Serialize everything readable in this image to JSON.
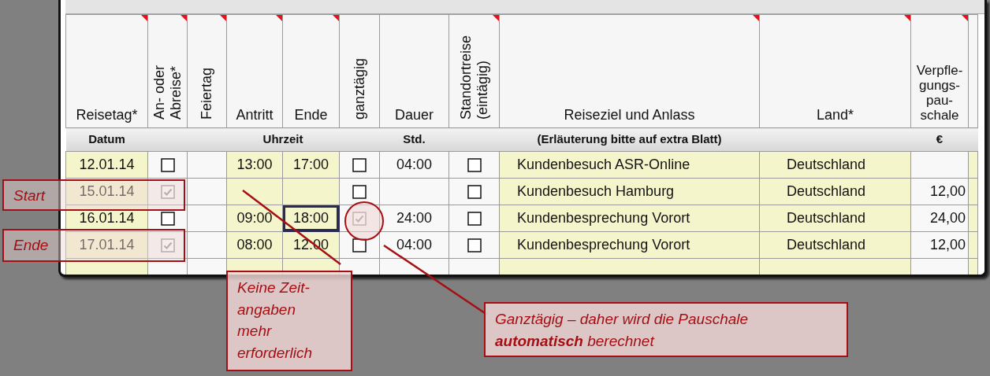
{
  "columns": [
    {
      "label": "Reisetag*",
      "kind": "horizontal",
      "comment": true
    },
    {
      "label": "An- oder Abreise*",
      "kind": "vertical",
      "comment": true
    },
    {
      "label": "Feiertag",
      "kind": "vertical",
      "comment": true
    },
    {
      "label": "Antritt",
      "kind": "horizontal",
      "comment": true
    },
    {
      "label": "Ende",
      "kind": "horizontal",
      "comment": true
    },
    {
      "label": "ganztägig",
      "kind": "vertical",
      "comment": false
    },
    {
      "label": "Dauer",
      "kind": "horizontal",
      "comment": false
    },
    {
      "label": "Standortreise (eintägig)",
      "kind": "vertical",
      "comment": true
    },
    {
      "label": "Reiseziel und Anlass",
      "kind": "horizontal",
      "comment": true
    },
    {
      "label": "Land*",
      "kind": "horizontal",
      "comment": true
    },
    {
      "label": "Verpfle-gungs-pau-schale",
      "kind": "horizontal",
      "comment": true
    }
  ],
  "subheaders": [
    "Datum",
    "Uhrzeit",
    "Std.",
    "(Erläuterung bitte auf extra Blatt)",
    "€"
  ],
  "rows": [
    {
      "date": "12.01.14",
      "arrival_departure": false,
      "start": "13:00",
      "end": "17:00",
      "end_selected": false,
      "full_day": false,
      "duration": "04:00",
      "standort": false,
      "destination": "Kundenbesuch ASR-Online",
      "country": "Deutschland"
    },
    {
      "date": "15.01.14",
      "arrival_departure": true,
      "end_selected": false,
      "full_day": false,
      "standort": false,
      "destination": "Kundenbesuch Hamburg",
      "country": "Deutschland",
      "allowance": "12,00"
    },
    {
      "date": "16.01.14",
      "arrival_departure": false,
      "start": "09:00",
      "end": "18:00",
      "end_selected": true,
      "full_day": true,
      "duration": "24:00",
      "standort": false,
      "destination": "Kundenbesprechung Vorort",
      "country": "Deutschland",
      "allowance": "24,00"
    },
    {
      "date": "17.01.14",
      "arrival_departure": true,
      "start": "08:00",
      "end": "12:00",
      "end_selected": false,
      "full_day": false,
      "duration": "04:00",
      "standort": false,
      "destination": "Kundenbesprechung Vorort",
      "country": "Deutschland",
      "allowance": "12,00"
    }
  ],
  "callouts": [
    {
      "kind": "label",
      "lines": [
        "Start"
      ]
    },
    {
      "kind": "label",
      "lines": [
        "Ende"
      ]
    },
    {
      "kind": "note",
      "lines": [
        "Keine Zeit-",
        "angaben",
        "mehr",
        "erforderlich"
      ]
    },
    {
      "kind": "note",
      "lines": [
        "Ganztägig – daher wird die Pauschale",
        "**automatisch** berechnet"
      ]
    }
  ]
}
